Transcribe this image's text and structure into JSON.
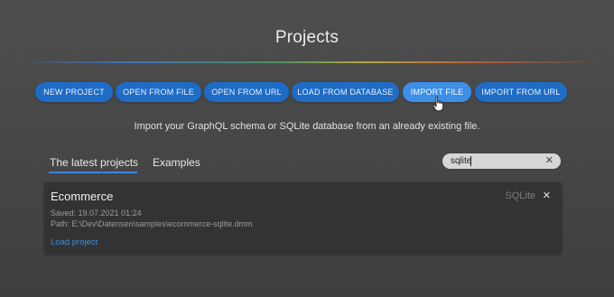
{
  "header": {
    "title": "Projects"
  },
  "toolbar": {
    "buttons": [
      {
        "label": "NEW PROJECT"
      },
      {
        "label": "OPEN FROM FILE"
      },
      {
        "label": "OPEN FROM URL"
      },
      {
        "label": "LOAD FROM DATABASE"
      },
      {
        "label": "IMPORT FILE"
      },
      {
        "label": "IMPORT FROM URL"
      }
    ],
    "accent": "#1f6cc6",
    "active_accent": "#3c8ee6"
  },
  "description": "Import your GraphQL schema or SQLite database from an already existing file.",
  "tabs": [
    {
      "label": "The latest projects",
      "active": true
    },
    {
      "label": "Examples",
      "active": false
    }
  ],
  "search": {
    "value": "sqlite",
    "clear_icon": "close-icon"
  },
  "projects": [
    {
      "name": "Ecommerce",
      "type": "SQLite",
      "saved": "Saved: 19.07.2021 01:24",
      "path": "Path: E:\\Dev\\Datensen\\samples\\ecommerce-sqlite.dmm",
      "action": "Load project",
      "remove_icon": "close-icon"
    }
  ]
}
